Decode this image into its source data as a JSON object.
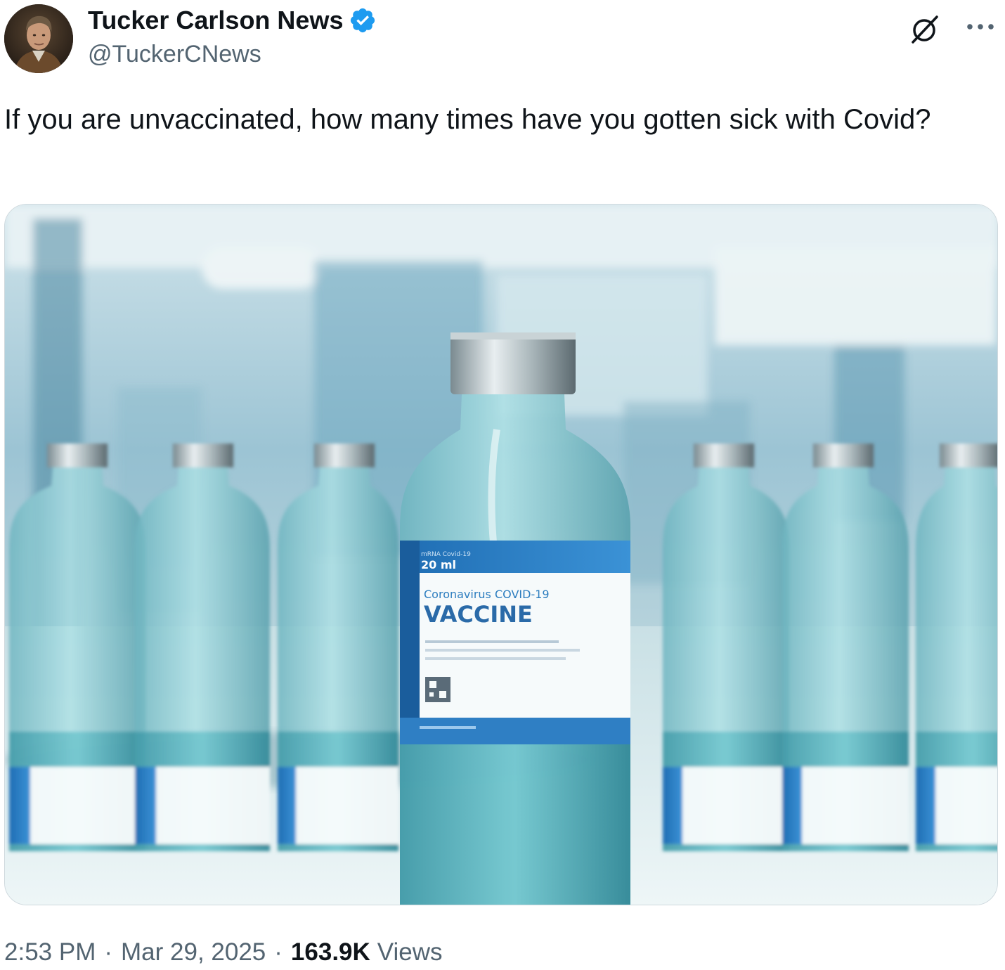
{
  "author": {
    "display_name": "Tucker Carlson News",
    "handle": "@TuckerCNews",
    "verified": true,
    "verified_color": "#1d9bf0"
  },
  "header_icons": {
    "grok": "grok-icon",
    "more": "more-options-icon"
  },
  "tweet": {
    "text": "If you are unvaccinated, how many times have you gotten sick with Covid?"
  },
  "media": {
    "vial_label": {
      "volume": "20 ml",
      "subtitle": "Coronavirus COVID-19",
      "title": "VACCINE"
    }
  },
  "meta": {
    "time": "2:53 PM",
    "separator": "·",
    "date": "Mar 29, 2025",
    "views_count": "163.9K",
    "views_label": "Views"
  },
  "colors": {
    "text_primary": "#0f1419",
    "text_secondary": "#536471",
    "border": "#cfd9de"
  }
}
